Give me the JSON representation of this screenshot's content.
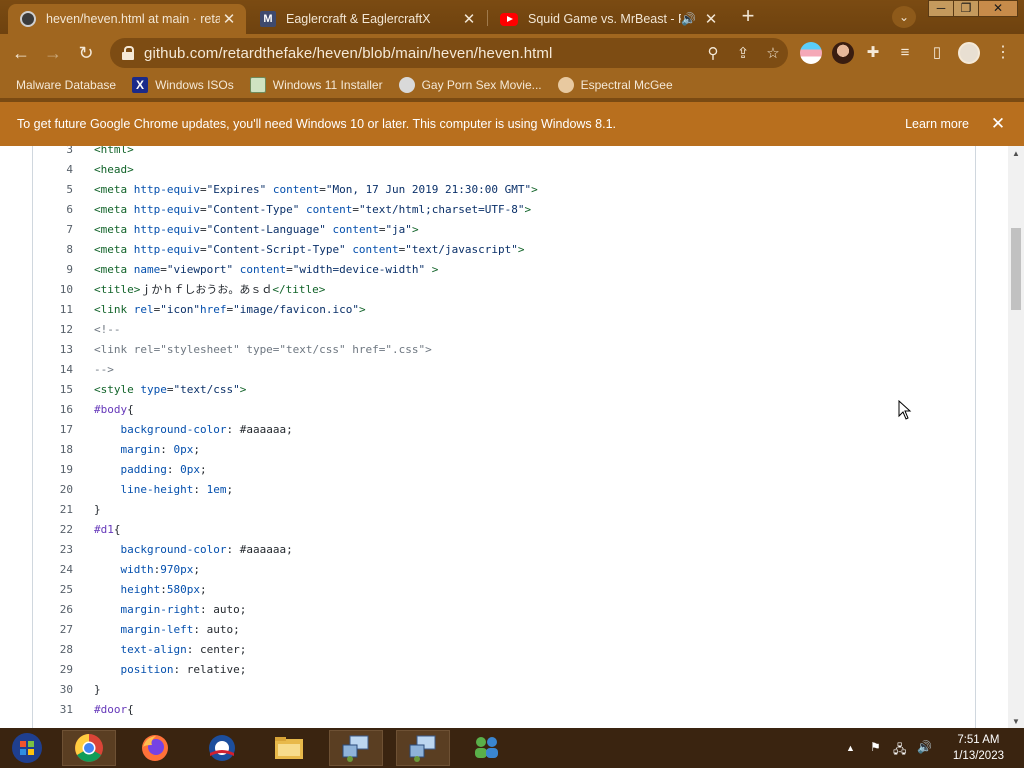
{
  "tabs": [
    {
      "title": "heven/heven.html at main · retardthefake/heven",
      "icon": "github-icon",
      "active": true
    },
    {
      "title": "Eaglercraft & EaglercraftX",
      "icon": "m-icon",
      "active": false
    },
    {
      "title": "Squid Game vs. MrBeast - Rap Battle",
      "icon": "youtube-icon",
      "active": false
    }
  ],
  "new_tab_label": "+",
  "window_controls": {
    "minimize": "─",
    "restore": "❐",
    "close": "✕"
  },
  "address_bar": {
    "url": "github.com/retardthefake/heven/blob/main/heven/heven.html"
  },
  "bookmarks": [
    {
      "label": "Malware Database"
    },
    {
      "label": "Windows ISOs"
    },
    {
      "label": "Windows 11 Installer"
    },
    {
      "label": "Gay Porn Sex Movie..."
    },
    {
      "label": "Espectral McGee"
    }
  ],
  "infobar": {
    "message": "To get future Google Chrome updates, you'll need Windows 10 or later. This computer is using Windows 8.1.",
    "action": "Learn more",
    "close": "✕"
  },
  "code_lines": [
    {
      "n": "3",
      "html": "<span class=\"tag\">&lt;html&gt;</span>"
    },
    {
      "n": "4",
      "html": "<span class=\"tag\">&lt;head&gt;</span>"
    },
    {
      "n": "5",
      "html": "<span class=\"tag\">&lt;meta</span> <span class=\"attr\">http-equiv</span>=<span class=\"str\">\"Expires\"</span> <span class=\"attr\">content</span>=<span class=\"str\">\"Mon, 17 Jun 2019 21:30:00 GMT\"</span><span class=\"tag\">&gt;</span>"
    },
    {
      "n": "6",
      "html": "<span class=\"tag\">&lt;meta</span> <span class=\"attr\">http-equiv</span>=<span class=\"str\">\"Content-Type\"</span> <span class=\"attr\">content</span>=<span class=\"str\">\"text/html;charset=UTF-8\"</span><span class=\"tag\">&gt;</span>"
    },
    {
      "n": "7",
      "html": "<span class=\"tag\">&lt;meta</span> <span class=\"attr\">http-equiv</span>=<span class=\"str\">\"Content-Language\"</span> <span class=\"attr\">content</span>=<span class=\"str\">\"ja\"</span><span class=\"tag\">&gt;</span>"
    },
    {
      "n": "8",
      "html": "<span class=\"tag\">&lt;meta</span> <span class=\"attr\">http-equiv</span>=<span class=\"str\">\"Content-Script-Type\"</span> <span class=\"attr\">content</span>=<span class=\"str\">\"text/javascript\"</span><span class=\"tag\">&gt;</span>"
    },
    {
      "n": "9",
      "html": "<span class=\"tag\">&lt;meta</span> <span class=\"attr\">name</span>=<span class=\"str\">\"viewport\"</span> <span class=\"attr\">content</span>=<span class=\"str\">\"width=device-width\"</span> <span class=\"tag\">&gt;</span>"
    },
    {
      "n": "10",
      "html": "<span class=\"tag\">&lt;title&gt;</span>ｊかｈｆしおうお。あｓｄ<span class=\"tag\">&lt;/title&gt;</span>"
    },
    {
      "n": "11",
      "html": "<span class=\"tag\">&lt;link</span> <span class=\"attr\">rel</span>=<span class=\"str\">\"icon\"</span><span class=\"attr\">href</span>=<span class=\"str\">\"image/favicon.ico\"</span><span class=\"tag\">&gt;</span>"
    },
    {
      "n": "12",
      "html": "<span class=\"cmt\">&lt;!--</span>"
    },
    {
      "n": "13",
      "html": "<span class=\"cmt\">&lt;link rel=\"stylesheet\" type=\"text/css\" href=\".css\"&gt;</span>"
    },
    {
      "n": "14",
      "html": "<span class=\"cmt\">--&gt;</span>"
    },
    {
      "n": "15",
      "html": "<span class=\"tag\">&lt;style</span> <span class=\"attr\">type</span>=<span class=\"str\">\"text/css\"</span><span class=\"tag\">&gt;</span>"
    },
    {
      "n": "16",
      "html": "<span class=\"sel\">#body</span>{"
    },
    {
      "n": "17",
      "html": "    <span class=\"prop\">background-color</span>: #aaaaaa;"
    },
    {
      "n": "18",
      "html": "    <span class=\"prop\">margin</span>: <span class=\"attr\">0px</span>;"
    },
    {
      "n": "19",
      "html": "    <span class=\"prop\">padding</span>: <span class=\"attr\">0px</span>;"
    },
    {
      "n": "20",
      "html": "    <span class=\"prop\">line-height</span>: <span class=\"attr\">1em</span>;"
    },
    {
      "n": "21",
      "html": "}"
    },
    {
      "n": "22",
      "html": "<span class=\"sel\">#d1</span>{"
    },
    {
      "n": "23",
      "html": "    <span class=\"prop\">background-color</span>: #aaaaaa;"
    },
    {
      "n": "24",
      "html": "    <span class=\"prop\">width</span>:<span class=\"attr\">970px</span>;"
    },
    {
      "n": "25",
      "html": "    <span class=\"prop\">height</span>:<span class=\"attr\">580px</span>;"
    },
    {
      "n": "26",
      "html": "    <span class=\"prop\">margin-right</span>: auto;"
    },
    {
      "n": "27",
      "html": "    <span class=\"prop\">margin-left</span>: auto;"
    },
    {
      "n": "28",
      "html": "    <span class=\"prop\">text-align</span>: center;"
    },
    {
      "n": "29",
      "html": "    <span class=\"prop\">position</span>: relative;"
    },
    {
      "n": "30",
      "html": "}"
    },
    {
      "n": "31",
      "html": "<span class=\"sel\">#door</span>{"
    }
  ],
  "taskbar": {
    "items": [
      "start-button",
      "chrome",
      "firefox",
      "obama",
      "file-explorer",
      "network-app-1",
      "network-app-2",
      "messenger"
    ],
    "time": "7:51 AM",
    "date": "1/13/2023"
  },
  "colors": {
    "chrome_frame": "#a0661f",
    "infobar": "#b86f1e",
    "taskbar": "#3a2410"
  }
}
